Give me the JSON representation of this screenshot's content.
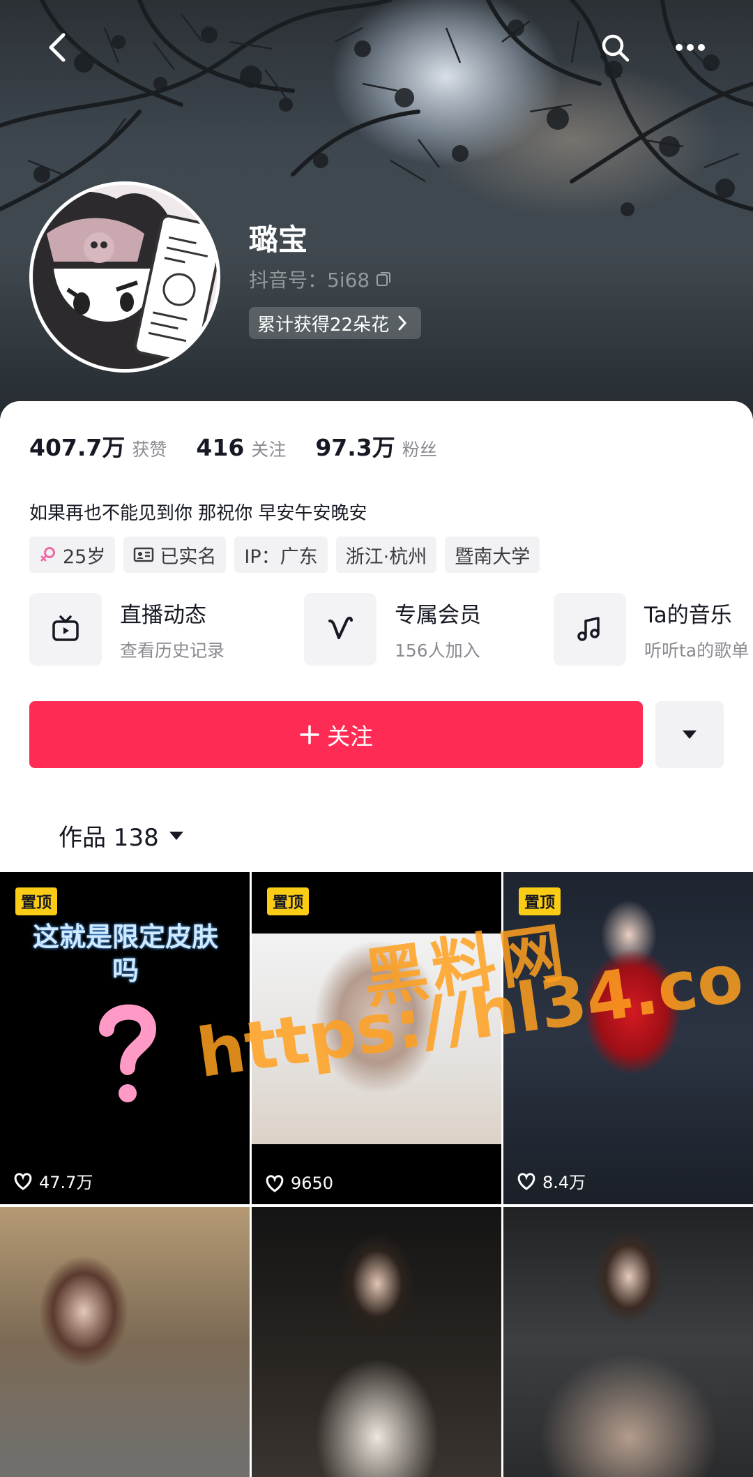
{
  "header": {
    "nickname": "璐宝",
    "douyin_id": "抖音号：5i68",
    "flowers": "累计获得22朵花"
  },
  "stats": [
    {
      "value": "407.7万",
      "label": "获赞"
    },
    {
      "value": "416",
      "label": "关注"
    },
    {
      "value": "97.3万",
      "label": "粉丝"
    }
  ],
  "bio": "如果再也不能见到你 那祝你 早安午安晚安",
  "tags": [
    "25岁",
    "已实名",
    "IP：广东",
    "浙江·杭州",
    "暨南大学"
  ],
  "features": [
    {
      "title": "直播动态",
      "subtitle": "查看历史记录",
      "icon": "tv-icon"
    },
    {
      "title": "专属会员",
      "subtitle": "156人加入",
      "icon": "v-badge-icon"
    },
    {
      "title": "Ta的音乐",
      "subtitle": "听听ta的歌单",
      "icon": "music-note-icon"
    }
  ],
  "actions": {
    "follow_label": "关注"
  },
  "works_tab": "作品 138",
  "grid": [
    {
      "pinned": "置顶",
      "caption": "这就是限定皮肤吗",
      "likes": "47.7万"
    },
    {
      "pinned": "置顶",
      "likes": "9650"
    },
    {
      "pinned": "置顶",
      "likes": "8.4万"
    },
    {},
    {},
    {}
  ],
  "watermark": {
    "line1": "黑料网",
    "line2": "https://hl34.co"
  },
  "colors": {
    "primary": "#fe2c55",
    "pin_badge": "#facc15",
    "watermark": "#ffa01e"
  }
}
